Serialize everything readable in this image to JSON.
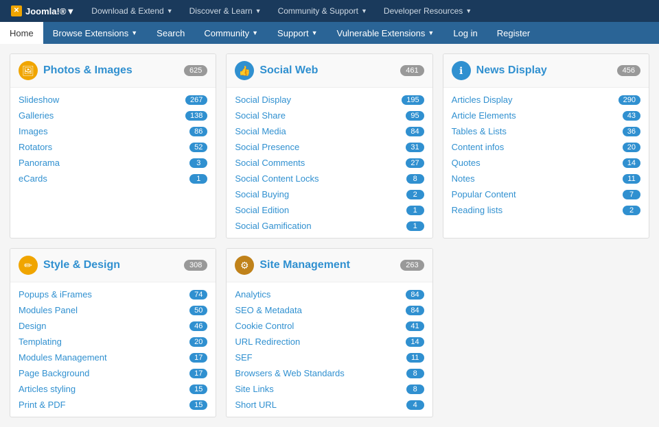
{
  "topNav": {
    "logo": "Joomla!®",
    "items": [
      {
        "label": "Download & Extend",
        "hasArrow": true
      },
      {
        "label": "Discover & Learn",
        "hasArrow": true
      },
      {
        "label": "Community & Support",
        "hasArrow": true
      },
      {
        "label": "Developer Resources",
        "hasArrow": true
      }
    ]
  },
  "mainNav": {
    "items": [
      {
        "label": "Home",
        "active": true
      },
      {
        "label": "Browse Extensions",
        "hasArrow": true
      },
      {
        "label": "Search"
      },
      {
        "label": "Community",
        "hasArrow": true
      },
      {
        "label": "Support",
        "hasArrow": true
      },
      {
        "label": "Vulnerable Extensions",
        "hasArrow": true
      },
      {
        "label": "Log in"
      },
      {
        "label": "Register"
      }
    ]
  },
  "categories": [
    {
      "id": "photos-images",
      "icon": "🖼",
      "iconClass": "icon-orange",
      "title": "Photos & Images",
      "count": "625",
      "items": [
        {
          "label": "Slideshow",
          "count": "267"
        },
        {
          "label": "Galleries",
          "count": "138"
        },
        {
          "label": "Images",
          "count": "86"
        },
        {
          "label": "Rotators",
          "count": "52"
        },
        {
          "label": "Panorama",
          "count": "3"
        },
        {
          "label": "eCards",
          "count": "1"
        }
      ]
    },
    {
      "id": "social-web",
      "icon": "👍",
      "iconClass": "icon-blue",
      "title": "Social Web",
      "count": "461",
      "items": [
        {
          "label": "Social Display",
          "count": "195"
        },
        {
          "label": "Social Share",
          "count": "95"
        },
        {
          "label": "Social Media",
          "count": "84"
        },
        {
          "label": "Social Presence",
          "count": "31"
        },
        {
          "label": "Social Comments",
          "count": "27"
        },
        {
          "label": "Social Content Locks",
          "count": "8"
        },
        {
          "label": "Social Buying",
          "count": "2"
        },
        {
          "label": "Social Edition",
          "count": "1"
        },
        {
          "label": "Social Gamification",
          "count": "1"
        }
      ]
    },
    {
      "id": "news-display",
      "icon": "ℹ",
      "iconClass": "icon-blue",
      "title": "News Display",
      "count": "456",
      "items": [
        {
          "label": "Articles Display",
          "count": "290"
        },
        {
          "label": "Article Elements",
          "count": "43"
        },
        {
          "label": "Tables & Lists",
          "count": "36"
        },
        {
          "label": "Content infos",
          "count": "20"
        },
        {
          "label": "Quotes",
          "count": "14"
        },
        {
          "label": "Notes",
          "count": "11"
        },
        {
          "label": "Popular Content",
          "count": "7"
        },
        {
          "label": "Reading lists",
          "count": "2"
        }
      ]
    },
    {
      "id": "style-design",
      "icon": "✏",
      "iconClass": "icon-orange",
      "title": "Style & Design",
      "count": "308",
      "items": [
        {
          "label": "Popups & iFrames",
          "count": "74"
        },
        {
          "label": "Modules Panel",
          "count": "50"
        },
        {
          "label": "Design",
          "count": "46"
        },
        {
          "label": "Templating",
          "count": "20"
        },
        {
          "label": "Modules Management",
          "count": "17"
        },
        {
          "label": "Page Background",
          "count": "17"
        },
        {
          "label": "Articles styling",
          "count": "15"
        },
        {
          "label": "Print & PDF",
          "count": "15"
        }
      ]
    },
    {
      "id": "site-management",
      "icon": "⚙",
      "iconClass": "icon-brown",
      "title": "Site Management",
      "count": "263",
      "items": [
        {
          "label": "Analytics",
          "count": "84"
        },
        {
          "label": "SEO & Metadata",
          "count": "84"
        },
        {
          "label": "Cookie Control",
          "count": "41"
        },
        {
          "label": "URL Redirection",
          "count": "14"
        },
        {
          "label": "SEF",
          "count": "11"
        },
        {
          "label": "Browsers & Web Standards",
          "count": "8"
        },
        {
          "label": "Site Links",
          "count": "8"
        },
        {
          "label": "Short URL",
          "count": "4"
        }
      ]
    }
  ]
}
